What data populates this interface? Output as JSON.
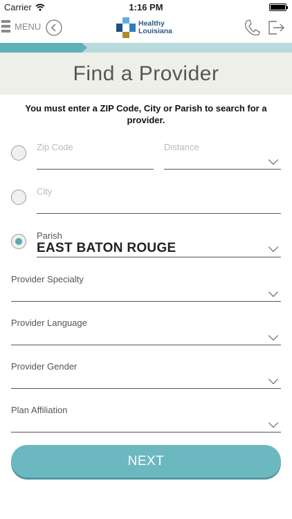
{
  "status_bar": {
    "carrier": "Carrier",
    "time": "1:16 PM"
  },
  "nav": {
    "menu_label": "MENU",
    "logo_line1": "Healthy",
    "logo_line2": "Louisiana"
  },
  "progress": {
    "fraction": 0.28
  },
  "page": {
    "title": "Find a Provider",
    "notice": "You must enter a ZIP Code, City or Parish to search for a provider."
  },
  "form": {
    "zip_label": "Zip Code",
    "distance_label": "Distance",
    "city_label": "City",
    "parish_label": "Parish",
    "parish_value": "EAST BATON ROUGE",
    "selected_search": "parish",
    "specialty_label": "Provider Specialty",
    "language_label": "Provider Language",
    "gender_label": "Provider Gender",
    "plan_label": "Plan Affiliation"
  },
  "next_label": "NEXT",
  "colors": {
    "accent": "#6cb8c1",
    "progress_track": "#b9dadd",
    "header_band": "#efefe9"
  }
}
